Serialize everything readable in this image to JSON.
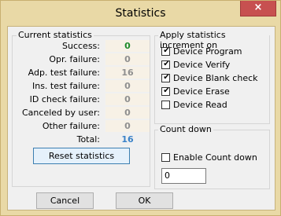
{
  "window": {
    "title": "Statistics",
    "close_glyph": "×"
  },
  "current_stats": {
    "title": "Current statistics",
    "rows": [
      {
        "label": "Success:",
        "value": "0"
      },
      {
        "label": "Opr. failure:",
        "value": "0"
      },
      {
        "label": "Adp. test failure:",
        "value": "16"
      },
      {
        "label": "Ins. test failure:",
        "value": "0"
      },
      {
        "label": "ID check failure:",
        "value": "0"
      },
      {
        "label": "Canceled by user:",
        "value": "0"
      },
      {
        "label": "Other failure:",
        "value": "0"
      },
      {
        "label": "Total:",
        "value": "16"
      }
    ],
    "reset_label": "Reset statistics"
  },
  "apply_increment": {
    "title": "Apply statistics increment on",
    "options": [
      {
        "label": "Device Program",
        "checked": true
      },
      {
        "label": "Device Verify",
        "checked": true
      },
      {
        "label": "Device Blank check",
        "checked": true
      },
      {
        "label": "Device Erase",
        "checked": true
      },
      {
        "label": "Device Read",
        "checked": false
      }
    ]
  },
  "count_down": {
    "title": "Count down",
    "enable_label": "Enable Count down",
    "enabled": false,
    "value": "0"
  },
  "footer": {
    "cancel_label": "Cancel",
    "ok_label": "OK"
  },
  "colors": {
    "success": "#1e8a2a",
    "total": "#3a82c8",
    "neutral": "#8f8f8f",
    "frame": "#e9d9a6",
    "close": "#c75050"
  }
}
